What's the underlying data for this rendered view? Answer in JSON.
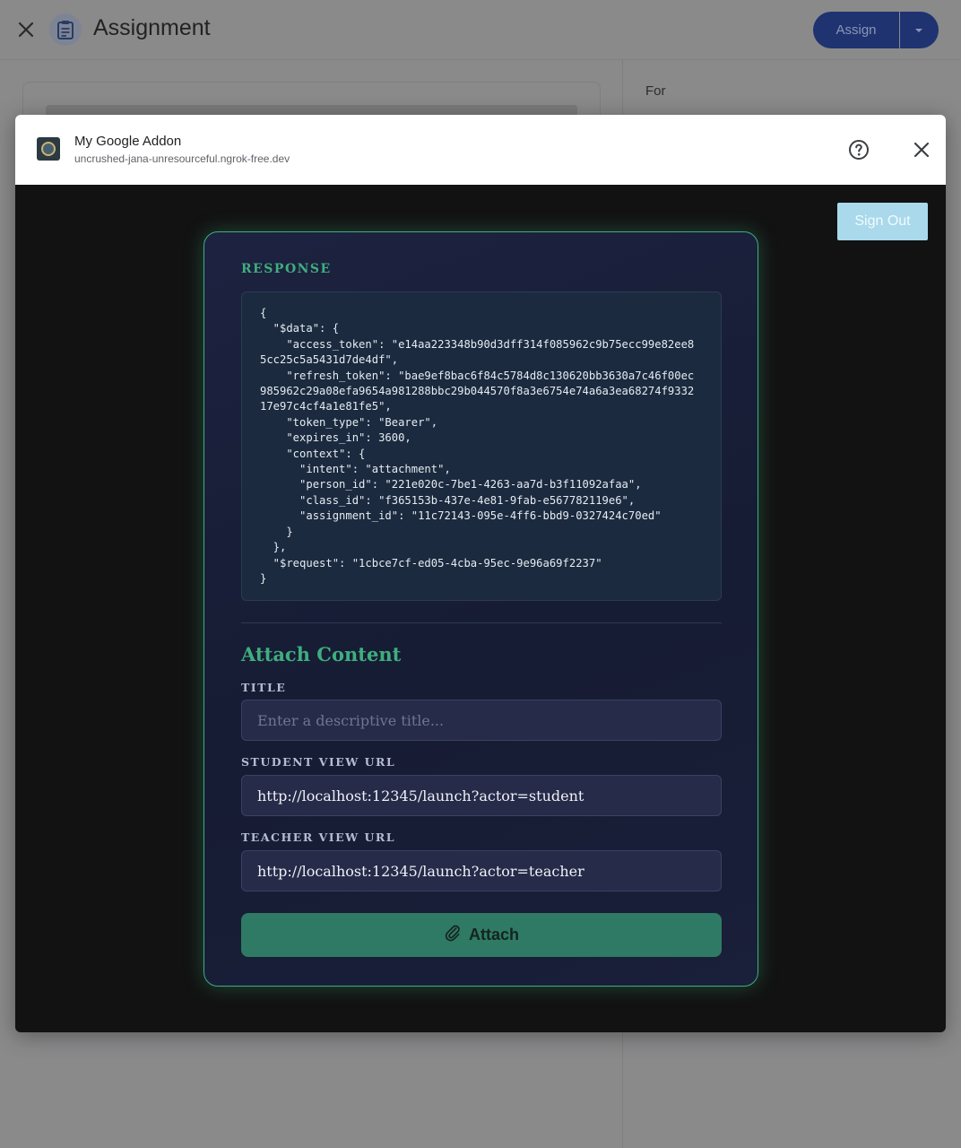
{
  "app": {
    "page_title": "Assignment",
    "assign_label": "Assign",
    "for_label": "For"
  },
  "dialog": {
    "addon_name": "My Google Addon",
    "addon_url": "uncrushed-jana-unresourceful.ngrok-free.dev",
    "sign_out_label": "Sign Out",
    "response": {
      "label": "RESPONSE",
      "code": "{\n  \"$data\": {\n    \"access_token\": \"e14aa223348b90d3dff314f085962c9b75ecc99e82ee8\n5cc25c5a5431d7de4df\",\n    \"refresh_token\": \"bae9ef8bac6f84c5784d8c130620bb3630a7c46f00ec\n985962c29a08efa9654a981288bbc29b044570f8a3e6754e74a6a3ea68274f9332\n17e97c4cf4a1e81fe5\",\n    \"token_type\": \"Bearer\",\n    \"expires_in\": 3600,\n    \"context\": {\n      \"intent\": \"attachment\",\n      \"person_id\": \"221e020c-7be1-4263-aa7d-b3f11092afaa\",\n      \"class_id\": \"f365153b-437e-4e81-9fab-e567782119e6\",\n      \"assignment_id\": \"11c72143-095e-4ff6-bbd9-0327424c70ed\"\n    }\n  },\n  \"$request\": \"1cbce7cf-ed05-4cba-95ec-9e96a69f2237\"\n}"
    },
    "attach": {
      "heading": "Attach Content",
      "title_label": "TITLE",
      "title_placeholder": "Enter a descriptive title...",
      "title_value": "",
      "student_label": "STUDENT VIEW URL",
      "student_value": "http://localhost:12345/launch?actor=student",
      "teacher_label": "TEACHER VIEW URL",
      "teacher_value": "http://localhost:12345/launch?actor=teacher",
      "button_label": "Attach"
    }
  },
  "colors": {
    "accent": "#3fae7e",
    "sign_out_bg": "#a9d9ea",
    "attach_button": "#2f7a64"
  }
}
